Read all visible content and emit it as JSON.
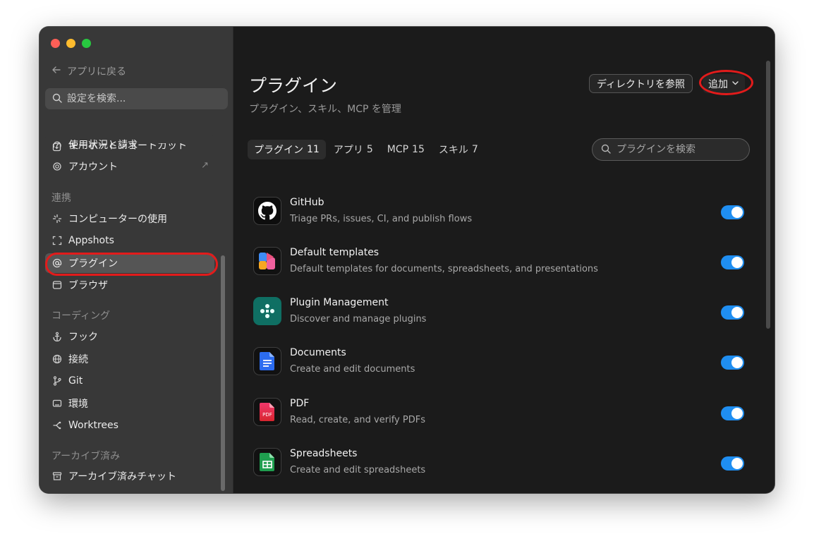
{
  "sidebar": {
    "back_label": "アプリに戻る",
    "search_placeholder": "設定を検索...",
    "top_items": [
      {
        "label": "キーボードショートカット",
        "icon": "keyboard-shortcut-icon"
      },
      {
        "label": "使用状況と請求",
        "icon": "gauge-icon"
      },
      {
        "label": "アカウント",
        "icon": "openai-logo-icon",
        "external": true
      }
    ],
    "sections": {
      "integrations": "連携",
      "coding": "コーディング",
      "archived": "アーカイブ済み"
    },
    "integration_items": [
      {
        "label": "コンピューターの使用",
        "icon": "sparkle-icon"
      },
      {
        "label": "Appshots",
        "icon": "screenshot-frame-icon"
      },
      {
        "label": "プラグイン",
        "icon": "at-sign-icon",
        "active": true
      },
      {
        "label": "ブラウザ",
        "icon": "browser-icon"
      }
    ],
    "coding_items": [
      {
        "label": "フック",
        "icon": "anchor-icon"
      },
      {
        "label": "接続",
        "icon": "globe-icon"
      },
      {
        "label": "Git",
        "icon": "git-branch-icon"
      },
      {
        "label": "環境",
        "icon": "monitor-icon"
      },
      {
        "label": "Worktrees",
        "icon": "worktree-icon"
      }
    ],
    "archived_items": [
      {
        "label": "アーカイブ済みチャット",
        "icon": "archive-box-icon"
      }
    ]
  },
  "main": {
    "title": "プラグイン",
    "subtitle": "プラグイン、スキル、MCP を管理",
    "browse_directory_label": "ディレクトリを参照",
    "add_label": "追加",
    "tabs": [
      {
        "label": "プラグイン",
        "count": "11",
        "active": true
      },
      {
        "label": "アプリ",
        "count": "5"
      },
      {
        "label": "MCP",
        "count": "15"
      },
      {
        "label": "スキル",
        "count": "7"
      }
    ],
    "search_placeholder": "プラグインを検索",
    "plugins": [
      {
        "name": "GitHub",
        "description": "Triage PRs, issues, CI, and publish flows",
        "icon": "github-icon",
        "enabled": true
      },
      {
        "name": "Default templates",
        "description": "Default templates for documents, spreadsheets, and presentations",
        "icon": "templates-icon",
        "enabled": true
      },
      {
        "name": "Plugin Management",
        "description": "Discover and manage plugins",
        "icon": "plugin-management-icon",
        "enabled": true
      },
      {
        "name": "Documents",
        "description": "Create and edit documents",
        "icon": "document-icon",
        "enabled": true
      },
      {
        "name": "PDF",
        "description": "Read, create, and verify PDFs",
        "icon": "pdf-icon",
        "icon_text": "PDF",
        "enabled": true
      },
      {
        "name": "Spreadsheets",
        "description": "Create and edit spreadsheets",
        "icon": "spreadsheet-icon",
        "enabled": true
      }
    ]
  },
  "colors": {
    "accent": "#1f8ef1",
    "highlight": "#e21b1b",
    "background": "#1b1b1b",
    "sidebar": "#383838"
  }
}
